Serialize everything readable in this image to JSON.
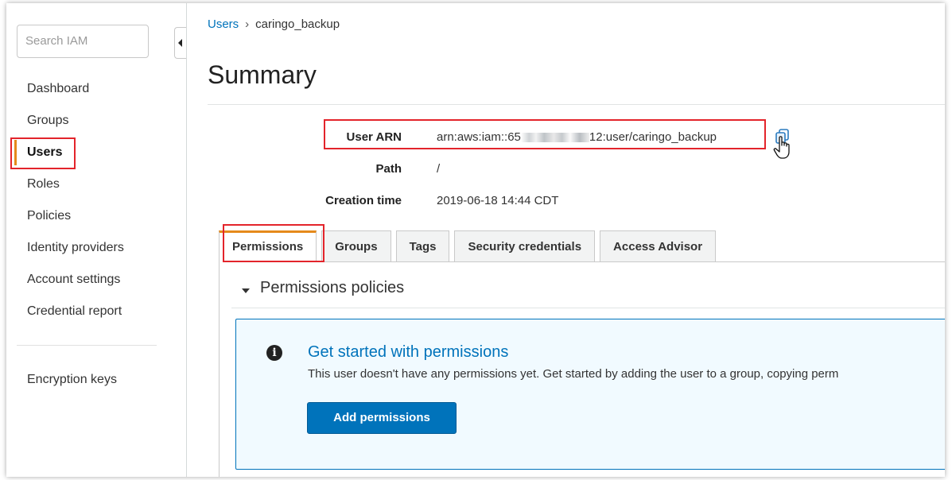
{
  "sidebar": {
    "search_placeholder": "Search IAM",
    "items": [
      {
        "label": "Dashboard"
      },
      {
        "label": "Groups"
      },
      {
        "label": "Users"
      },
      {
        "label": "Roles"
      },
      {
        "label": "Policies"
      },
      {
        "label": "Identity providers"
      },
      {
        "label": "Account settings"
      },
      {
        "label": "Credential report"
      }
    ],
    "encryption_label": "Encryption keys"
  },
  "breadcrumb": {
    "root": "Users",
    "current": "caringo_backup"
  },
  "page_title": "Summary",
  "summary": {
    "arn_label": "User ARN",
    "arn_prefix": "arn:aws:iam::65",
    "arn_suffix": "12:user/caringo_backup",
    "path_label": "Path",
    "path_value": "/",
    "creation_label": "Creation time",
    "creation_value": "2019-06-18 14:44 CDT"
  },
  "tabs": [
    {
      "label": "Permissions",
      "active": true
    },
    {
      "label": "Groups"
    },
    {
      "label": "Tags"
    },
    {
      "label": "Security credentials"
    },
    {
      "label": "Access Advisor"
    }
  ],
  "permissions": {
    "section_title": "Permissions policies",
    "info_title": "Get started with permissions",
    "info_text": "This user doesn't have any permissions yet. Get started by adding the user to a group, copying perm",
    "add_button": "Add permissions"
  },
  "colors": {
    "accent_orange": "#e58a1b",
    "link_blue": "#0073bb",
    "highlight_red": "#e3242b"
  }
}
